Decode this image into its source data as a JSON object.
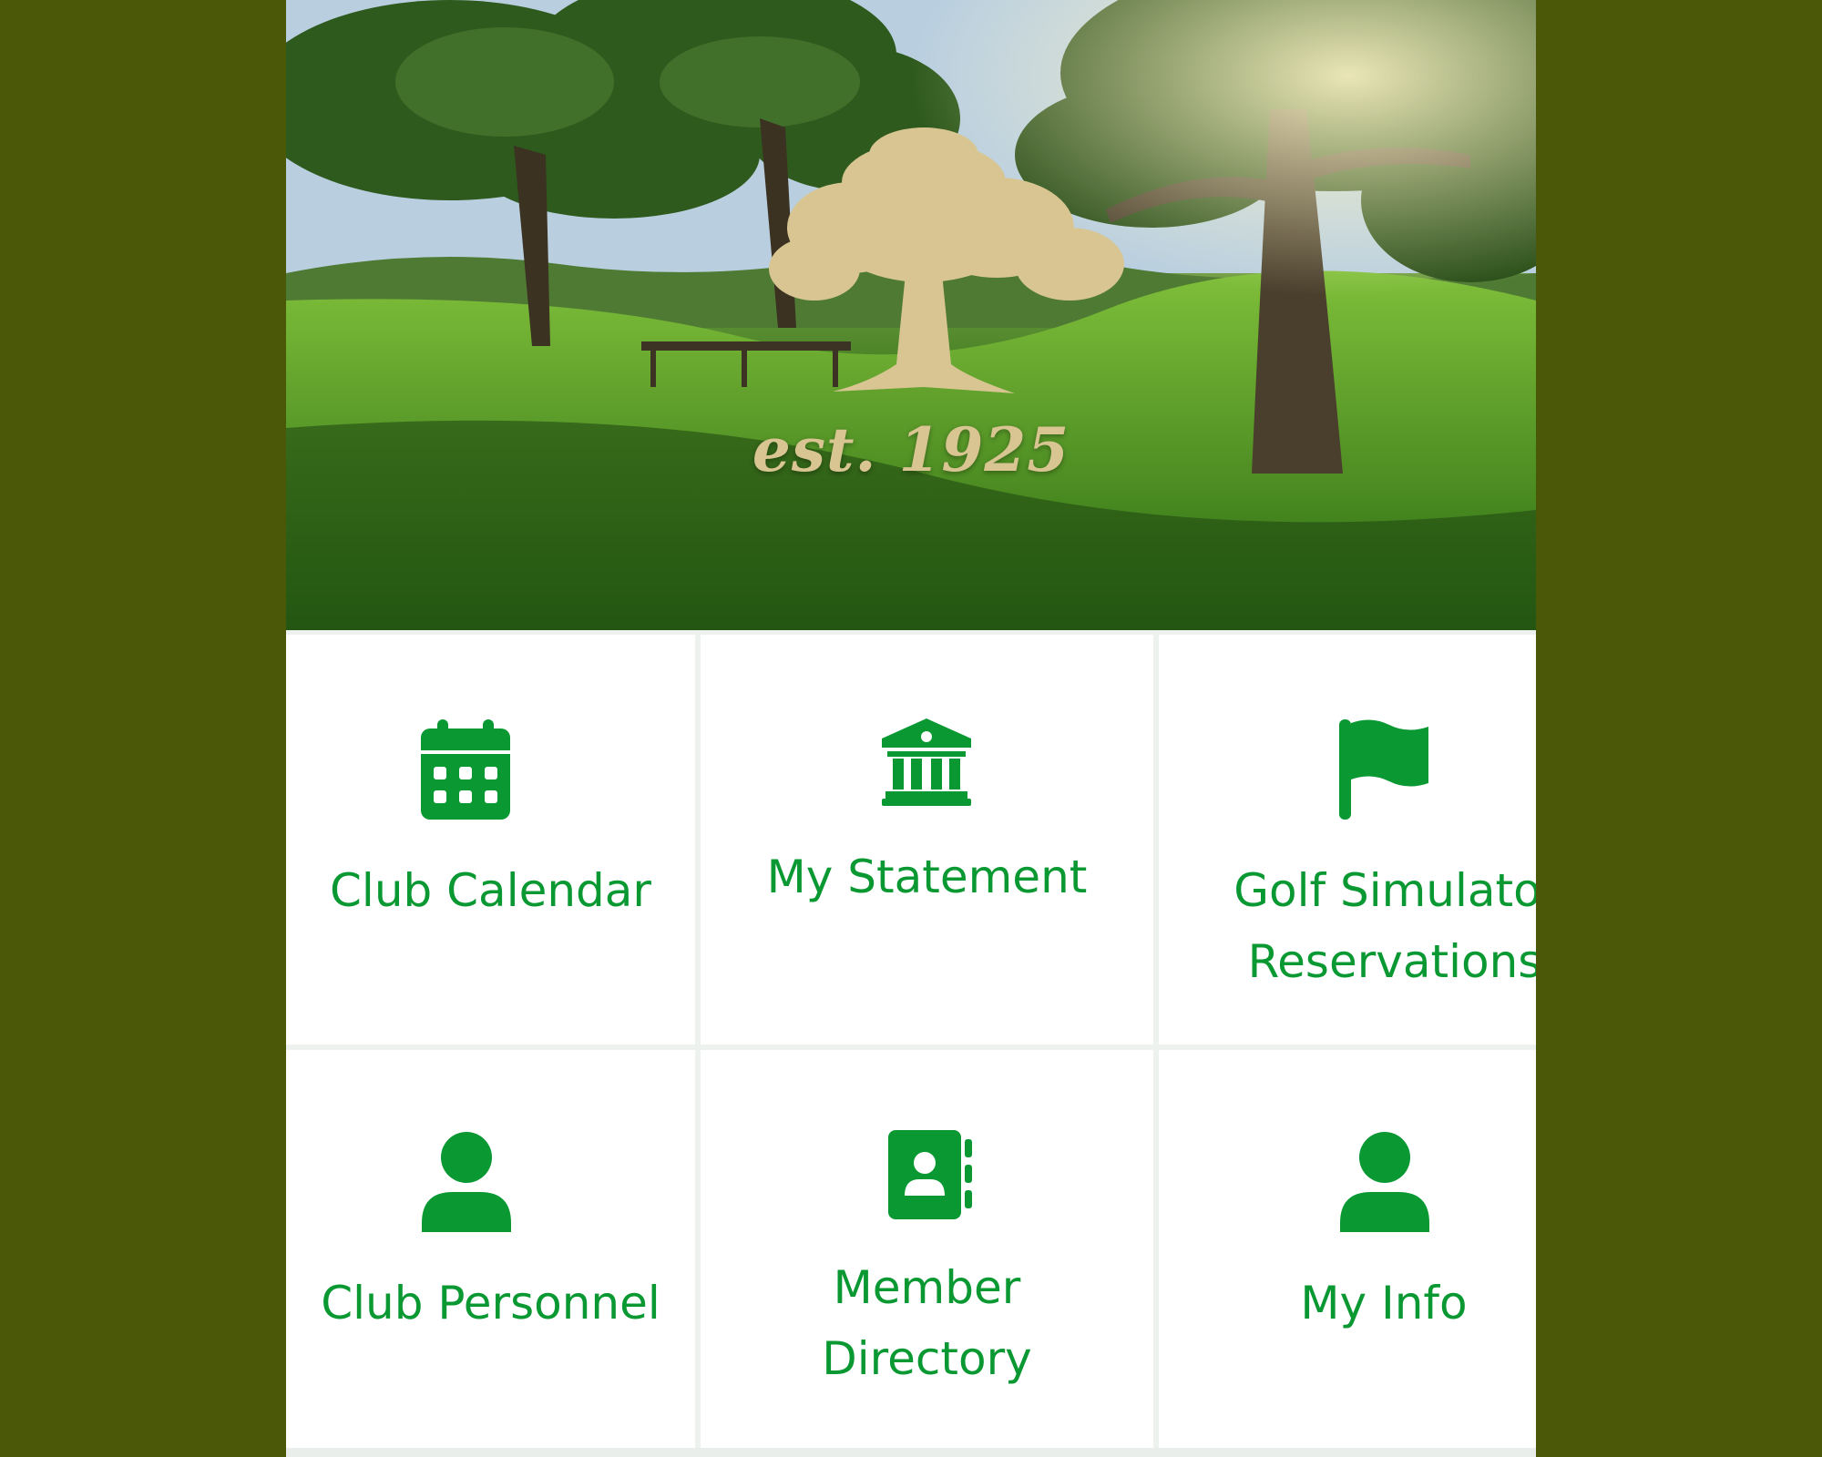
{
  "hero": {
    "est_text": "est. 1925"
  },
  "tiles": {
    "club_calendar": {
      "label": "Club Calendar",
      "icon": "calendar-icon"
    },
    "my_statement": {
      "label": "My Statement",
      "icon": "bank-icon"
    },
    "golf_simulator": {
      "label_line1": "Golf Simulato",
      "label_line2": "Reservations",
      "icon": "flag-icon"
    },
    "club_personnel": {
      "label": "Club Personnel",
      "icon": "user-icon"
    },
    "member_directory": {
      "label_line1": "Member",
      "label_line2": "Directory",
      "icon": "address-book-icon"
    },
    "my_info": {
      "label": "My Info",
      "icon": "user-icon"
    }
  },
  "colors": {
    "accent": "#0a9832",
    "background": "#4a5807",
    "tile_background": "#ffffff",
    "grid_line": "#dff0e4",
    "logo_tan": "#d8c592"
  }
}
